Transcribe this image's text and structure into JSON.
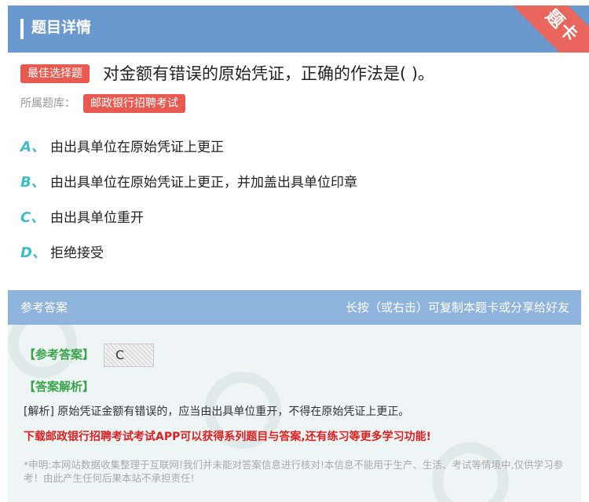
{
  "header": {
    "title": "题目详情",
    "corner_label": "题卡"
  },
  "question": {
    "type_badge": "最佳选择题",
    "text": "对金额有错误的原始凭证，正确的作法是( )。",
    "bank_label": "所属题库：",
    "bank_name": "邮政银行招聘考试"
  },
  "options": [
    {
      "letter": "A、",
      "text": "由出具单位在原始凭证上更正"
    },
    {
      "letter": "B、",
      "text": "由出具单位在原始凭证上更正，并加盖出具单位印章"
    },
    {
      "letter": "C、",
      "text": "由出具单位重开"
    },
    {
      "letter": "D、",
      "text": "拒绝接受"
    }
  ],
  "answer": {
    "header_left": "参考答案",
    "header_right": "长按（或右击）可复制本题卡或分享给好友",
    "ref_label": "【参考答案】",
    "ref_value": "C",
    "analysis_label": "【答案解析】",
    "analysis_text": "[解析] 原始凭证金额有错误的，应当由出具单位重开，不得在原始凭证上更正。",
    "promo_text": "下载邮政银行招聘考试考试APP可以获得系列题目与答案,还有练习等更多学习功能!",
    "disclaimer": "*申明:本网站数据收集整理于互联网!我们并未能对答案信息进行核对!本信息不能用于生产、生活、考试等情境中,仅供学习参考！由此产生任何后果本站不承担责任!"
  },
  "colors": {
    "header_bg": "#6a99d0",
    "badge_red": "#e85a4f",
    "option_letter": "#3fbcc8",
    "answer_green": "#3aa34a",
    "promo_red": "#e02020"
  }
}
